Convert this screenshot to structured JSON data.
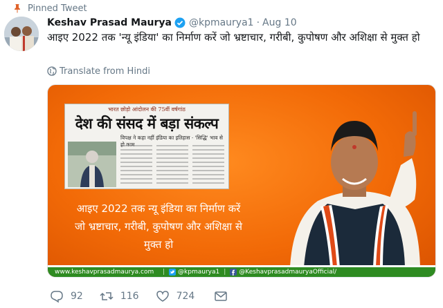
{
  "pinned_label": "Pinned Tweet",
  "author": {
    "name": "Keshav Prasad Maurya",
    "handle": "@kpmaurya1",
    "separator": "·",
    "date": "Aug 10",
    "verified": true
  },
  "tweet": {
    "text": "आइए 2022 तक 'न्यू इंडिया' का निर्माण करें जो भ्रष्टाचार, गरीबी, कुपोषण और अशिक्षा से मुक्त हो",
    "translate_label": "Translate from Hindi"
  },
  "media": {
    "clipping": {
      "kicker": "भारत छोड़ो आंदोलन की 75वीं वर्षगांठ",
      "headline": "देश की संसद में बड़ा संकल्प",
      "subhead": "विपक्ष ने कहा नहीं इंडिया का इतिहास · 'सिद्धि' भाव से हो काम"
    },
    "slogan_lines": [
      "आइए 2022 तक न्यू इंडिया का निर्माण करें",
      "जो भ्रष्टाचार, गरीबी, कुपोषण और अशिक्षा से",
      "मुक्त हो"
    ],
    "footer": {
      "website": "www.keshavprasadmaurya.com",
      "separator": "|",
      "twitter": "@kpmaurya1",
      "facebook": "@KeshavprasadmauryaOfficial/"
    }
  },
  "actions": {
    "replies": "92",
    "retweets": "116",
    "likes": "724"
  },
  "colors": {
    "saffron": "#f26a07",
    "banner_green": "#2e8b22",
    "muted_text": "#657786",
    "verified_blue": "#1da1f2",
    "pin_orange": "#e0632a"
  }
}
